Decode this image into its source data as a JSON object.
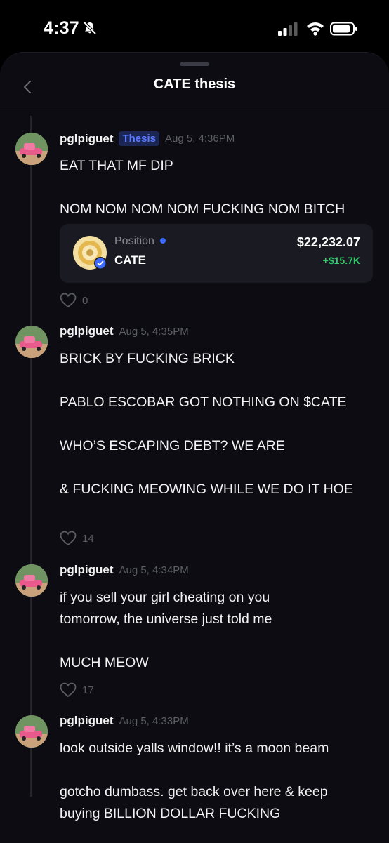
{
  "status_bar": {
    "time": "4:37"
  },
  "header": {
    "title": "CATE thesis"
  },
  "posts": [
    {
      "username": "pglpiguet",
      "tag": "Thesis",
      "timestamp": "Aug 5, 4:36PM",
      "lines": [
        "EAT THAT MF DIP",
        "NOM NOM NOM NOM FUCKING NOM BITCH"
      ],
      "position": {
        "label": "Position",
        "ticker": "CATE",
        "value": "$22,232.07",
        "pnl": "+$15.7K"
      },
      "likes": "0"
    },
    {
      "username": "pglpiguet",
      "timestamp": "Aug 5, 4:35PM",
      "lines": [
        "BRICK BY FUCKING BRICK",
        "PABLO ESCOBAR GOT NOTHING ON $CATE",
        "WHO’S ESCAPING DEBT? WE ARE",
        "& FUCKING MEOWING WHILE WE DO IT HOE"
      ],
      "likes": "14"
    },
    {
      "username": "pglpiguet",
      "timestamp": "Aug 5, 4:34PM",
      "lines": [
        "if you sell your girl cheating on you tomorrow, the universe just told me",
        "MUCH MEOW"
      ],
      "likes": "17"
    },
    {
      "username": "pglpiguet",
      "timestamp": "Aug 5, 4:33PM",
      "lines": [
        "look outside yalls window!! it’s a moon beam",
        "gotcho dumbass. get back over here & keep buying BILLION DOLLAR FUCKING"
      ]
    }
  ],
  "colors": {
    "background": "#0c0c12",
    "accent": "#3e6bff",
    "pnl_positive": "#2fd06b",
    "tag_bg": "#1c2654"
  },
  "icons": [
    "bell-off-icon",
    "signal-icon",
    "wifi-icon",
    "battery-icon",
    "chevron-left-icon",
    "heart-icon",
    "verified-icon",
    "coin-icon"
  ]
}
